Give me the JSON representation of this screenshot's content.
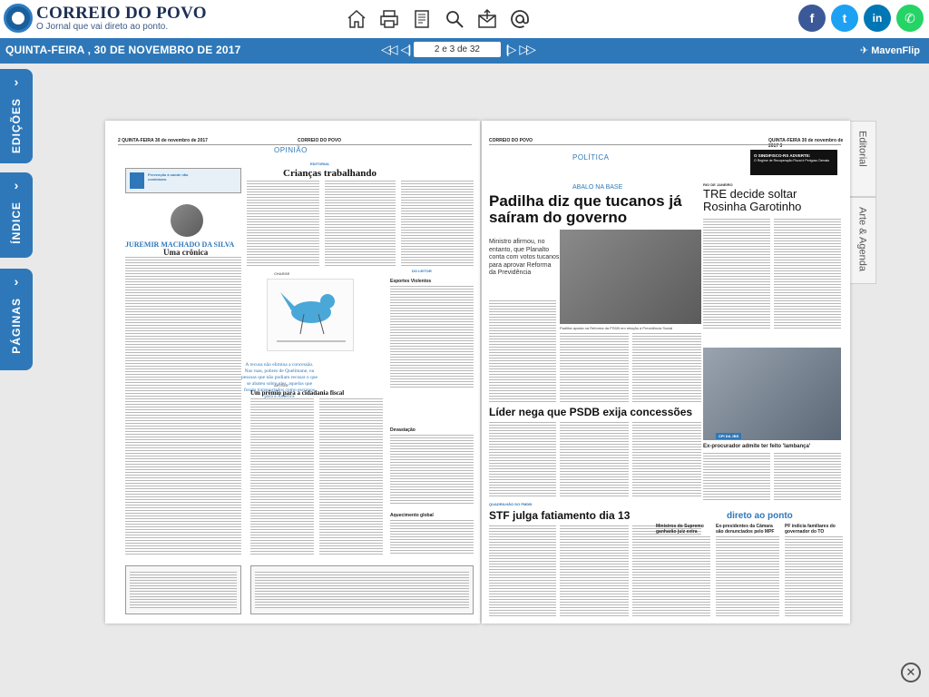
{
  "brand": {
    "title": "CORREIO DO POVO",
    "tagline": "O Jornal que vai direto ao ponto."
  },
  "toolbar": {
    "icons": [
      "home-icon",
      "print-icon",
      "document-icon",
      "search-icon",
      "share-icon",
      "email-icon"
    ]
  },
  "social": [
    {
      "name": "facebook",
      "glyph": "f",
      "color": "#3b5998"
    },
    {
      "name": "twitter",
      "glyph": "t",
      "color": "#1da1f2"
    },
    {
      "name": "linkedin",
      "glyph": "in",
      "color": "#0077b5"
    },
    {
      "name": "whatsapp",
      "glyph": "✆",
      "color": "#25d366"
    }
  ],
  "navbar": {
    "date": "QUINTA-FEIRA , 30 DE NOVEMBRO DE 2017",
    "page_indicator": "2 e 3 de 32",
    "maven": "MavenFlip"
  },
  "left_tabs": [
    "EDIÇÕES",
    "ÍNDICE",
    "PÁGINAS"
  ],
  "right_tabs": [
    "Editorial",
    "Arte & Agenda"
  ],
  "left_page": {
    "running_head": "2  QUINTA-FEIRA 30 de novembro de 2017",
    "running_brand": "CORREIO DO POVO",
    "section": "OPINIÃO",
    "editorial_tag": "EDITORIAL",
    "editorial_title": "Crianças trabalhando",
    "columnist": "JUREMIR MACHADO DA SILVA",
    "column_title": "Uma crônica",
    "charge_label": "CHARGE",
    "artigo_label": "ARTIGO",
    "artigo_title": "Um prêmio para a cidadania fiscal",
    "leitor_label": "DO LEITOR",
    "letter1_title": "Esportes Violentos",
    "letter2_title": "Devastação",
    "letter3_title": "Aquecimento global",
    "pullquote": "A recusa não elimina a concessão. Nas ruas, pobres de Quelimane, ou pessoas que não podiam recusar o que se abateu sobre eles, aquelas que foram transportados como escravos para a América",
    "ad_text": "Prevenção à saúde não combinam."
  },
  "right_page": {
    "running_head": "CORREIO DO POVO",
    "running_date": "QUINTA-FEIRA 30 de novembro de 2017  3",
    "section": "POLÍTICA",
    "kicker": "ABALO NA BASE",
    "headline": "Padilha diz que tucanos já saíram do governo",
    "deck": "Ministro afirmou, no entanto, que Planalto conta com votos tucanos para aprovar Reforma da Previdência",
    "photo_caption": "Padilha aposta na Reforma da PSDB em relação à Previdência Social",
    "sub_headline": "Líder nega que PSDB exija concessões",
    "stf_kicker": "QUADRILHÃO DO PMDB",
    "stf_headline": "STF julga fatiamento dia 13",
    "ad_title": "O SINDIFISCO-RS ADVERTE:",
    "ad_sub": "O Regime de Recuperação Fiscal é Perigoso Demais",
    "tre_kicker": "RIO DE JANEIRO",
    "tre_headline": "TRE decide soltar Rosinha Garotinho",
    "photo2_caption": "CPI DA JBS",
    "photo2_title": "Ex-procurador admite ter feito 'lambança'",
    "direto_title": "direto ao ponto",
    "direto1": "Ministros do Supremo ganharão juiz extra",
    "direto2": "Ex-presidentes da Câmara são denunciados pelo MPF",
    "direto3": "PF indicia familiares do governador do TO"
  }
}
